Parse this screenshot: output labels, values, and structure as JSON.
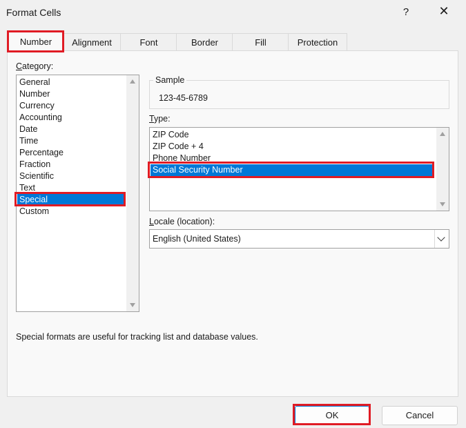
{
  "window": {
    "title": "Format Cells",
    "help": "?",
    "close": "✕"
  },
  "tabs": [
    {
      "label": "Number",
      "active": true
    },
    {
      "label": "Alignment"
    },
    {
      "label": "Font"
    },
    {
      "label": "Border"
    },
    {
      "label": "Fill"
    },
    {
      "label": "Protection"
    }
  ],
  "category": {
    "label_mnemonic": "C",
    "label_rest": "ategory:",
    "items": [
      "General",
      "Number",
      "Currency",
      "Accounting",
      "Date",
      "Time",
      "Percentage",
      "Fraction",
      "Scientific",
      "Text",
      "Special",
      "Custom"
    ],
    "selected": "Special"
  },
  "sample": {
    "label": "Sample",
    "value": "123-45-6789"
  },
  "type": {
    "label_mnemonic": "T",
    "label_rest": "ype:",
    "items": [
      "ZIP Code",
      "ZIP Code + 4",
      "Phone Number",
      "Social Security Number"
    ],
    "selected": "Social Security Number"
  },
  "locale": {
    "label_mnemonic": "L",
    "label_rest": "ocale (location):",
    "value": "English (United States)"
  },
  "description": "Special formats are useful for tracking list and database values.",
  "buttons": {
    "ok": "OK",
    "cancel": "Cancel"
  },
  "colors": {
    "selection": "#0078d7",
    "highlight_box": "#e01b24"
  }
}
